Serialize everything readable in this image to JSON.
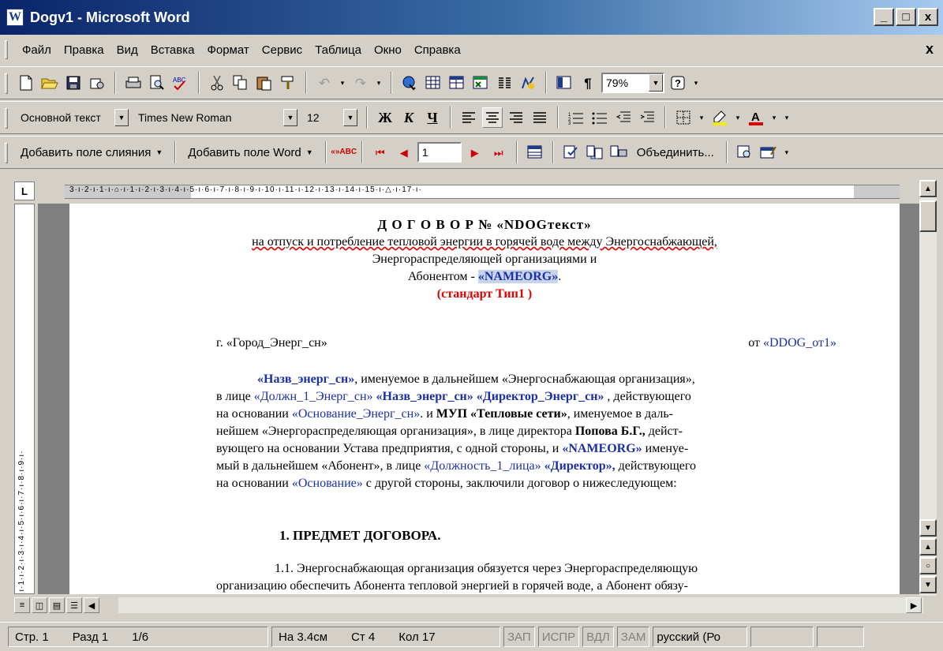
{
  "window": {
    "title": "Dogv1 - Microsoft Word",
    "app_glyph": "W",
    "minimize": "_",
    "maximize": "□",
    "close": "x"
  },
  "menu": {
    "items": [
      "Файл",
      "Правка",
      "Вид",
      "Вставка",
      "Формат",
      "Сервис",
      "Таблица",
      "Окно",
      "Справка"
    ],
    "close_doc": "x"
  },
  "standard_toolbar": {
    "zoom": "79%",
    "icons": [
      "new-icon",
      "open-icon",
      "save-icon",
      "permission-icon",
      "print-icon",
      "print-preview-icon",
      "spelling-icon",
      "cut-icon",
      "copy-icon",
      "paste-icon",
      "format-painter-icon",
      "undo-icon",
      "redo-icon",
      "hyperlink-icon",
      "tables-borders-icon",
      "insert-table-icon",
      "insert-excel-icon",
      "columns-icon",
      "drawing-icon",
      "document-map-icon",
      "show-marks-icon",
      "help-icon"
    ]
  },
  "formatting_toolbar": {
    "style": "Основной текст",
    "font": "Times New Roman",
    "size": "12",
    "bold": "Ж",
    "italic": "К",
    "underline": "Ч"
  },
  "mailmerge_toolbar": {
    "add_merge_field": "Добавить поле слияния",
    "add_word_field": "Добавить поле Word",
    "abc_label": "«»ABC",
    "record": "1",
    "merge": "Объединить..."
  },
  "ruler": {
    "corner": "L",
    "horizontal": "3·ı·2·ı·1·ı·⌂·ı·1·ı·2·ı·3·ı·4·ı·5·ı·6·ı·7·ı·8·ı·9·ı·10·ı·11·ı·12·ı·13·ı·14·ı·15·ı·△·ı·17·ı·",
    "vertical": "·ı·1·ı·2·ı·3·ı·4·ı·5·ı·6·ı·7·ı·8·ı·9·ı·"
  },
  "doc": {
    "title": "Д О Г О В О Р № «NDOGтекст»",
    "subtitle1": "на отпуск и потребление тепловой энергии в горячей воде между Энергоснабжающей,",
    "subtitle2": "Энергораспределяющей организациями и",
    "subtitle3_pre": "Абонентом - ",
    "subtitle3_field": "«NAMEORG»",
    "subtitle3_post": ".",
    "standard": "(стандарт Тип1 )",
    "city": "г. «Город_Энерг_сн»",
    "date_pre": "от ",
    "date_field": "«DDOG_от1»",
    "p1_l1a": "«Назв_энерг_сн»",
    "p1_l1b": ", именуемое в дальнейшем «Энергоснабжающая организация»,",
    "p1_l2a": "в лице ",
    "p1_l2b": "«Должн_1_Энерг_сн»",
    "p1_l2c": " «Назв_энерг_сн» «Директор_Энерг_сн»",
    "p1_l2d": " , действующего",
    "p1_l3a": "на основании ",
    "p1_l3b": "«Основание_Энерг_сн»",
    "p1_l3c": ". и ",
    "p1_l3d": "МУП «Тепловые сети»",
    "p1_l3e": ", именуемое в даль-",
    "p1_l4a": "нейшем «Энергораспределяющая организация», в лице директора ",
    "p1_l4b": "Попова Б.Г.,",
    "p1_l4c": " дейст-",
    "p1_l5a": "вующего на основании Устава предприятия, с одной стороны, и ",
    "p1_l5b": "«NAMEORG»",
    "p1_l5c": " именуе-",
    "p1_l6a": "мый в дальнейшем «Абонент», в лице ",
    "p1_l6b": "«Должность_1_лица»",
    "p1_l6c": " «Директор»,",
    "p1_l6d": " действующего",
    "p1_l7a": "на основании ",
    "p1_l7b": "«Основание»",
    "p1_l7c": " с другой стороны, заключили договор о нижеследующем:",
    "section1": "1.  ПРЕДМЕТ ДОГОВОРА.",
    "s11_l1": "1.1. Энергоснабжающая организация обязуется через Энергораспределяющую",
    "s11_l2": "организацию обеспечить Абонента тепловой энергией в горячей воде, а Абонент обязу-"
  },
  "status": {
    "page": "Стр. 1",
    "section": "Разд 1",
    "pages": "1/6",
    "at": "На 3.4см",
    "line": "Ст 4",
    "col": "Кол 17",
    "rec": "ЗАП",
    "trk": "ИСПР",
    "ext": "ВДЛ",
    "ovr": "ЗАМ",
    "lang": "русский (Ро"
  },
  "colors": {
    "merge_field": "#1a2fa8",
    "standard_red": "#e00000",
    "titlebar": "#0a246a"
  }
}
